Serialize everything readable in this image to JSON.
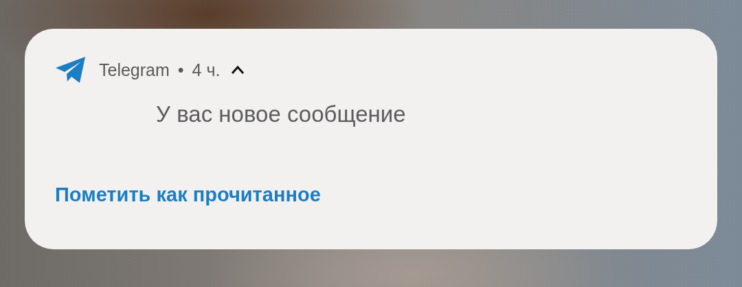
{
  "notification": {
    "app_name": "Telegram",
    "separator": "•",
    "time": "4 ч.",
    "expanded": true,
    "message": "У вас новое сообщение",
    "actions": [
      {
        "label": "Пометить как прочитанное"
      }
    ]
  }
}
